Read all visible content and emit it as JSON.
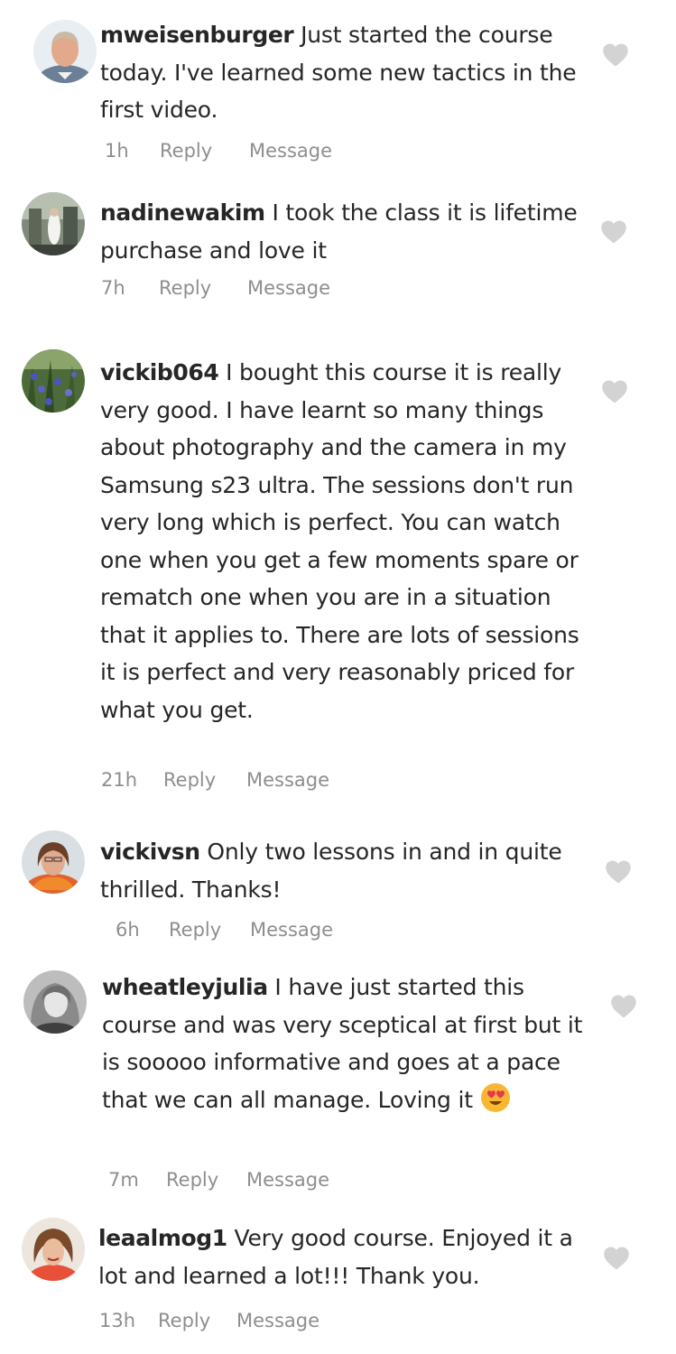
{
  "comments": [
    {
      "username": "mweisenburger",
      "text": "Just started the course today. I've learned some new tactics in the first video.",
      "time": "1h",
      "reply_label": "Reply",
      "message_label": "Message",
      "avatar": "avatar-man-photo",
      "like_icon": "heart-icon"
    },
    {
      "username": "nadinewakim",
      "text": "I took the class it is lifetime purchase and love it",
      "time": "7h",
      "reply_label": "Reply",
      "message_label": "Message",
      "avatar": "avatar-indoor-photo",
      "like_icon": "heart-icon"
    },
    {
      "username": "vickib064",
      "text": "I bought this course it is really very good. I have learnt so many things about photography and the camera in my Samsung s23 ultra. The sessions don't run very long which is perfect. You can watch one when you get a few moments spare or rematch one when you are in a situation that it applies to. There are lots of sessions it is perfect and very reasonably priced for what you get.",
      "time": "21h",
      "reply_label": "Reply",
      "message_label": "Message",
      "avatar": "avatar-flowers-photo",
      "like_icon": "heart-icon"
    },
    {
      "username": "vickivsn",
      "text": "Only two lessons in and in quite thrilled. Thanks!",
      "time": "6h",
      "reply_label": "Reply",
      "message_label": "Message",
      "avatar": "avatar-woman-photo",
      "like_icon": "heart-icon"
    },
    {
      "username": "wheatleyjulia",
      "text": "I have just started this course and was very sceptical at first but it is sooooo informative and goes at a pace that we can all manage. Loving it",
      "emoji": "heart-eyes-emoji",
      "time": "7m",
      "reply_label": "Reply",
      "message_label": "Message",
      "avatar": "avatar-woman-bw-photo",
      "like_icon": "heart-icon"
    },
    {
      "username": "leaalmog1",
      "text": "Very good course. Enjoyed it a lot and learned a lot!!! Thank you.",
      "time": "13h",
      "reply_label": "Reply",
      "message_label": "Message",
      "avatar": "avatar-woman-red-photo",
      "like_icon": "heart-icon"
    }
  ],
  "colors": {
    "text": "#262626",
    "meta": "#8e8e8e",
    "heart": "#d3d3d3"
  }
}
